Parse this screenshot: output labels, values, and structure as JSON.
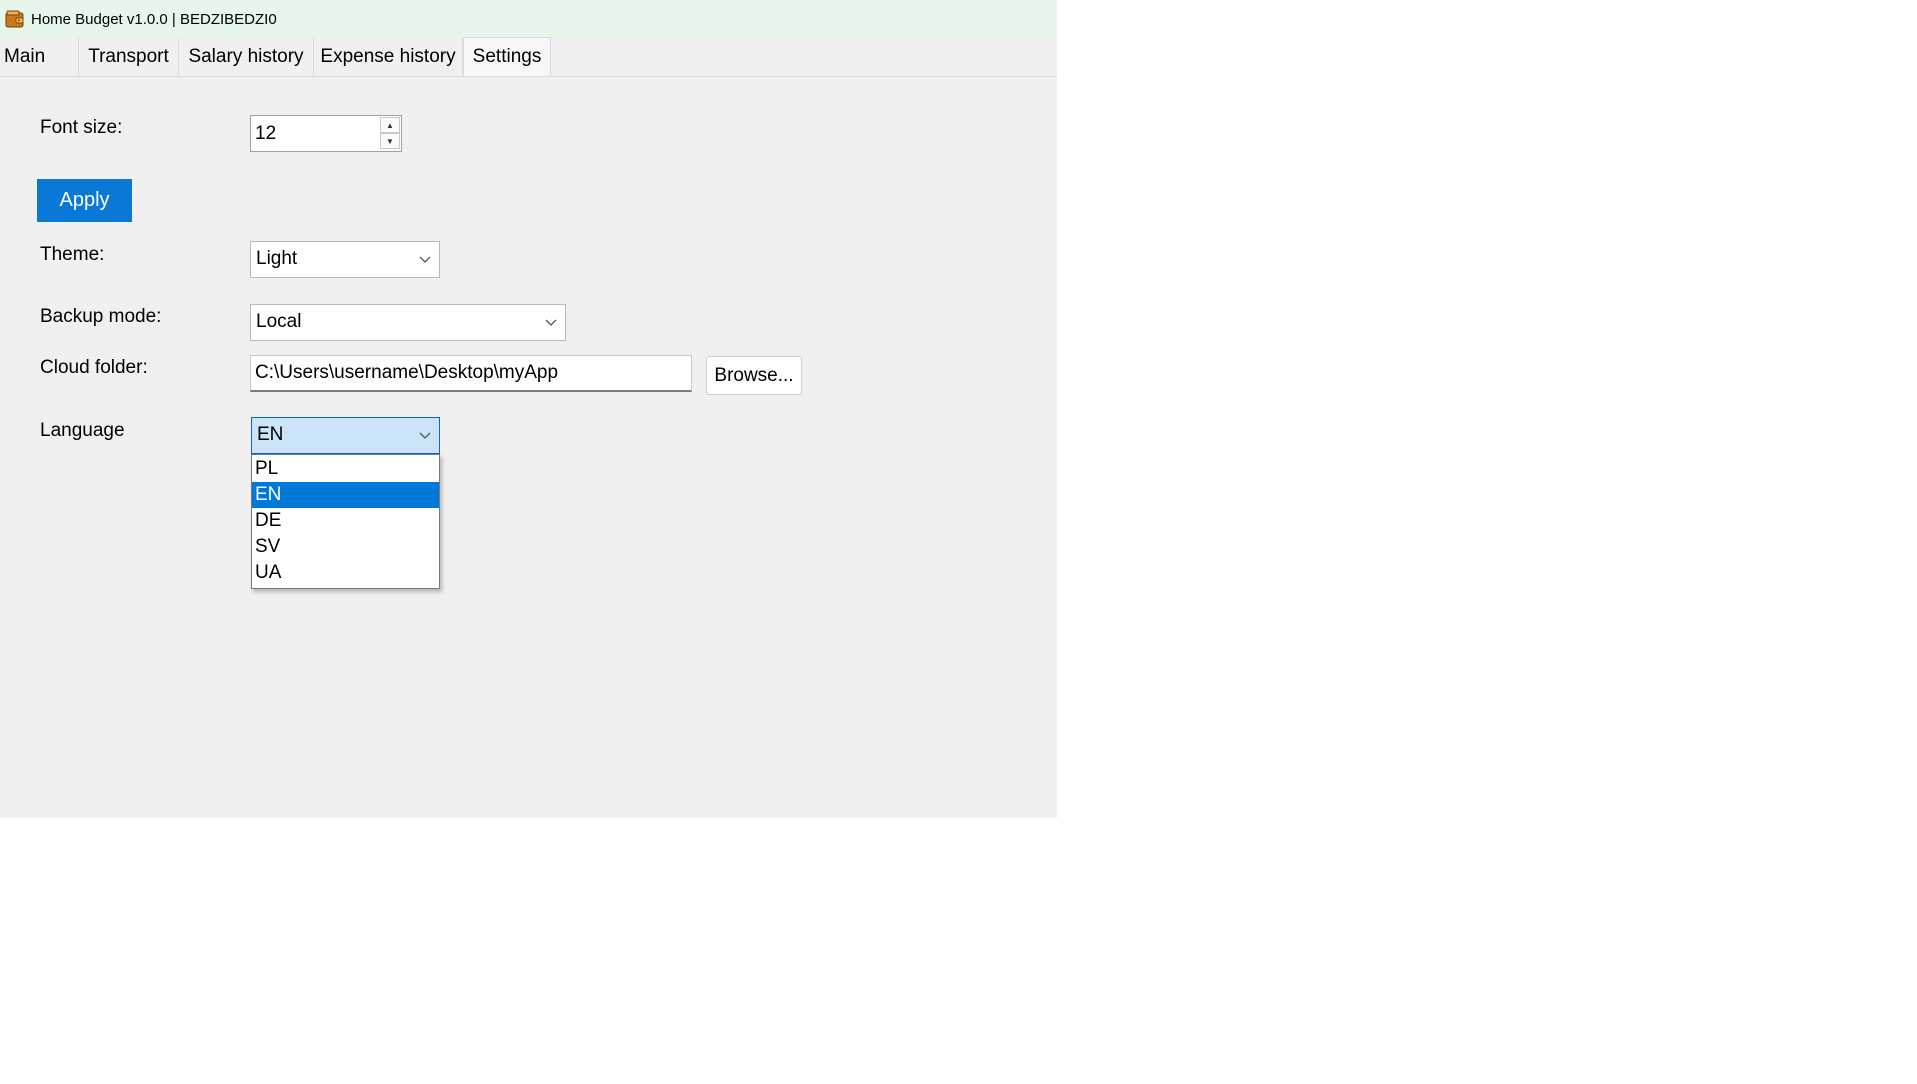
{
  "window": {
    "title": "Home Budget v1.0.0 | BEDZIBEDZI0"
  },
  "tabs": [
    {
      "label": "Main"
    },
    {
      "label": "Transport"
    },
    {
      "label": "Salary history"
    },
    {
      "label": "Expense history"
    },
    {
      "label": "Settings"
    }
  ],
  "active_tab": "Settings",
  "settings": {
    "font_size_label": "Font size:",
    "font_size_value": "12",
    "apply_label": "Apply",
    "theme_label": "Theme:",
    "theme_value": "Light",
    "backup_label": "Backup mode:",
    "backup_value": "Local",
    "cloud_label": "Cloud folder:",
    "cloud_value": "C:\\Users\\username\\Desktop\\myApp",
    "browse_label": "Browse...",
    "language_label": "Language",
    "language_value": "EN",
    "language_options": [
      "PL",
      "EN",
      "DE",
      "SV",
      "UA"
    ],
    "language_selected_index": 1
  },
  "icons": {
    "app": "wallet-icon",
    "chevron": "chevron-down-icon",
    "spin_up": "spin-up-icon",
    "spin_down": "spin-down-icon"
  },
  "colors": {
    "accent": "#0078d7",
    "titlebar": "#e6f6ea",
    "window_bg": "#f0f0f0"
  }
}
